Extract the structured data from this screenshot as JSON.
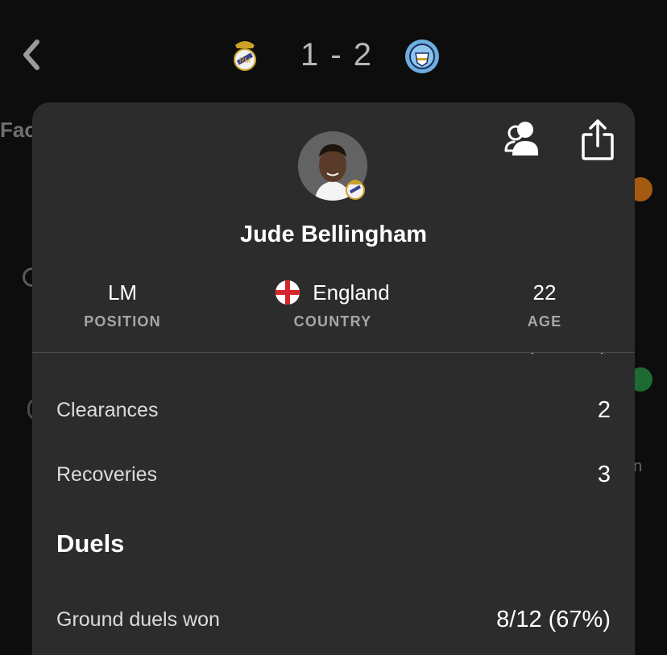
{
  "header": {
    "score": "1 - 2",
    "home_crest_icon": "real-madrid-crest-icon",
    "away_crest_icon": "manchester-city-crest-icon"
  },
  "background": {
    "tab_partial": "Fac",
    "side_letter": "n"
  },
  "player": {
    "name": "Jude Bellingham",
    "position_value": "LM",
    "position_label": "POSITION",
    "country_value": "England",
    "country_label": "COUNTRY",
    "age_value": "22",
    "age_label": "AGE"
  },
  "stats": [
    {
      "label": "Clearances",
      "value": "2"
    },
    {
      "label": "Recoveries",
      "value": "3"
    }
  ],
  "duels": {
    "title": "Duels",
    "rows": [
      {
        "label": "Ground duels won",
        "value": "8/12 (67%)"
      }
    ]
  },
  "colors": {
    "background": "#0d0d0d",
    "sheet": "#2c2c2c",
    "muted_label": "#a7a7a7"
  }
}
